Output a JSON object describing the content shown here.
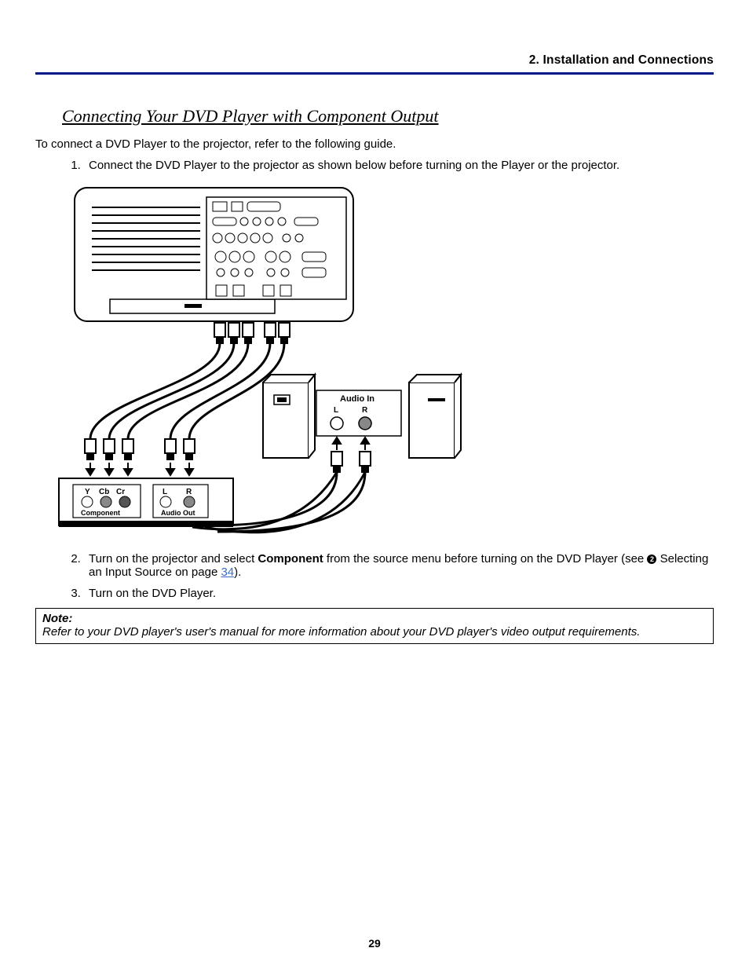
{
  "header": {
    "section_label": "2. Installation and Connections"
  },
  "title": "Connecting Your DVD Player with Component Output",
  "intro": "To connect a DVD Player to the projector, refer to the following guide.",
  "steps": {
    "s1": "Connect the DVD Player to the projector as shown below before turning on the Player or the projector.",
    "s2_a": "Turn on the projector and select ",
    "s2_bold": "Component",
    "s2_b": " from the source menu before turning on the DVD Player (see ",
    "s2_bullet_num": "2",
    "s2_c": " Selecting an Input Source on page ",
    "s2_link": "34",
    "s2_d": ").",
    "s3": "Turn on the DVD Player."
  },
  "note": {
    "label": "Note:",
    "body": "Refer to your DVD player's user's manual for more information about your DVD player's video output requirements."
  },
  "diagram_labels": {
    "audio_in": "Audio In",
    "L": "L",
    "R": "R",
    "Y": "Y",
    "Cb": "Cb",
    "Cr": "Cr",
    "component": "Component",
    "audio_out": "Audio Out"
  },
  "page_number": "29"
}
